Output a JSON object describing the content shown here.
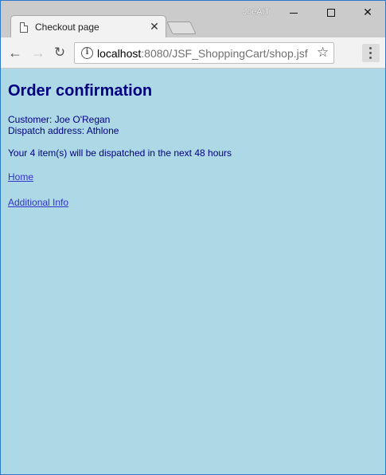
{
  "window": {
    "profile_name": "JoeAIT",
    "min_icon": "minimize-icon",
    "max_icon": "maximize-icon",
    "close_glyph": "✕"
  },
  "tab": {
    "title": "Checkout page",
    "close_glyph": "✕"
  },
  "toolbar": {
    "back_glyph": "←",
    "forward_glyph": "→",
    "reload_glyph": "↻",
    "url_host": "localhost",
    "url_rest": ":8080/JSF_ShoppingCart/shop.jsf",
    "star_glyph": "☆"
  },
  "page": {
    "title": "Order confirmation",
    "customer_line": "Customer: Joe O'Regan",
    "address_line": "Dispatch address: Athlone",
    "dispatch_message": "Your 4 item(s) will be dispatched in the next 48 hours",
    "home_link": "Home",
    "additional_info_link": "Additional Info"
  },
  "colors": {
    "page_background": "#add8e6",
    "text": "#000080",
    "link": "#3333cc"
  }
}
